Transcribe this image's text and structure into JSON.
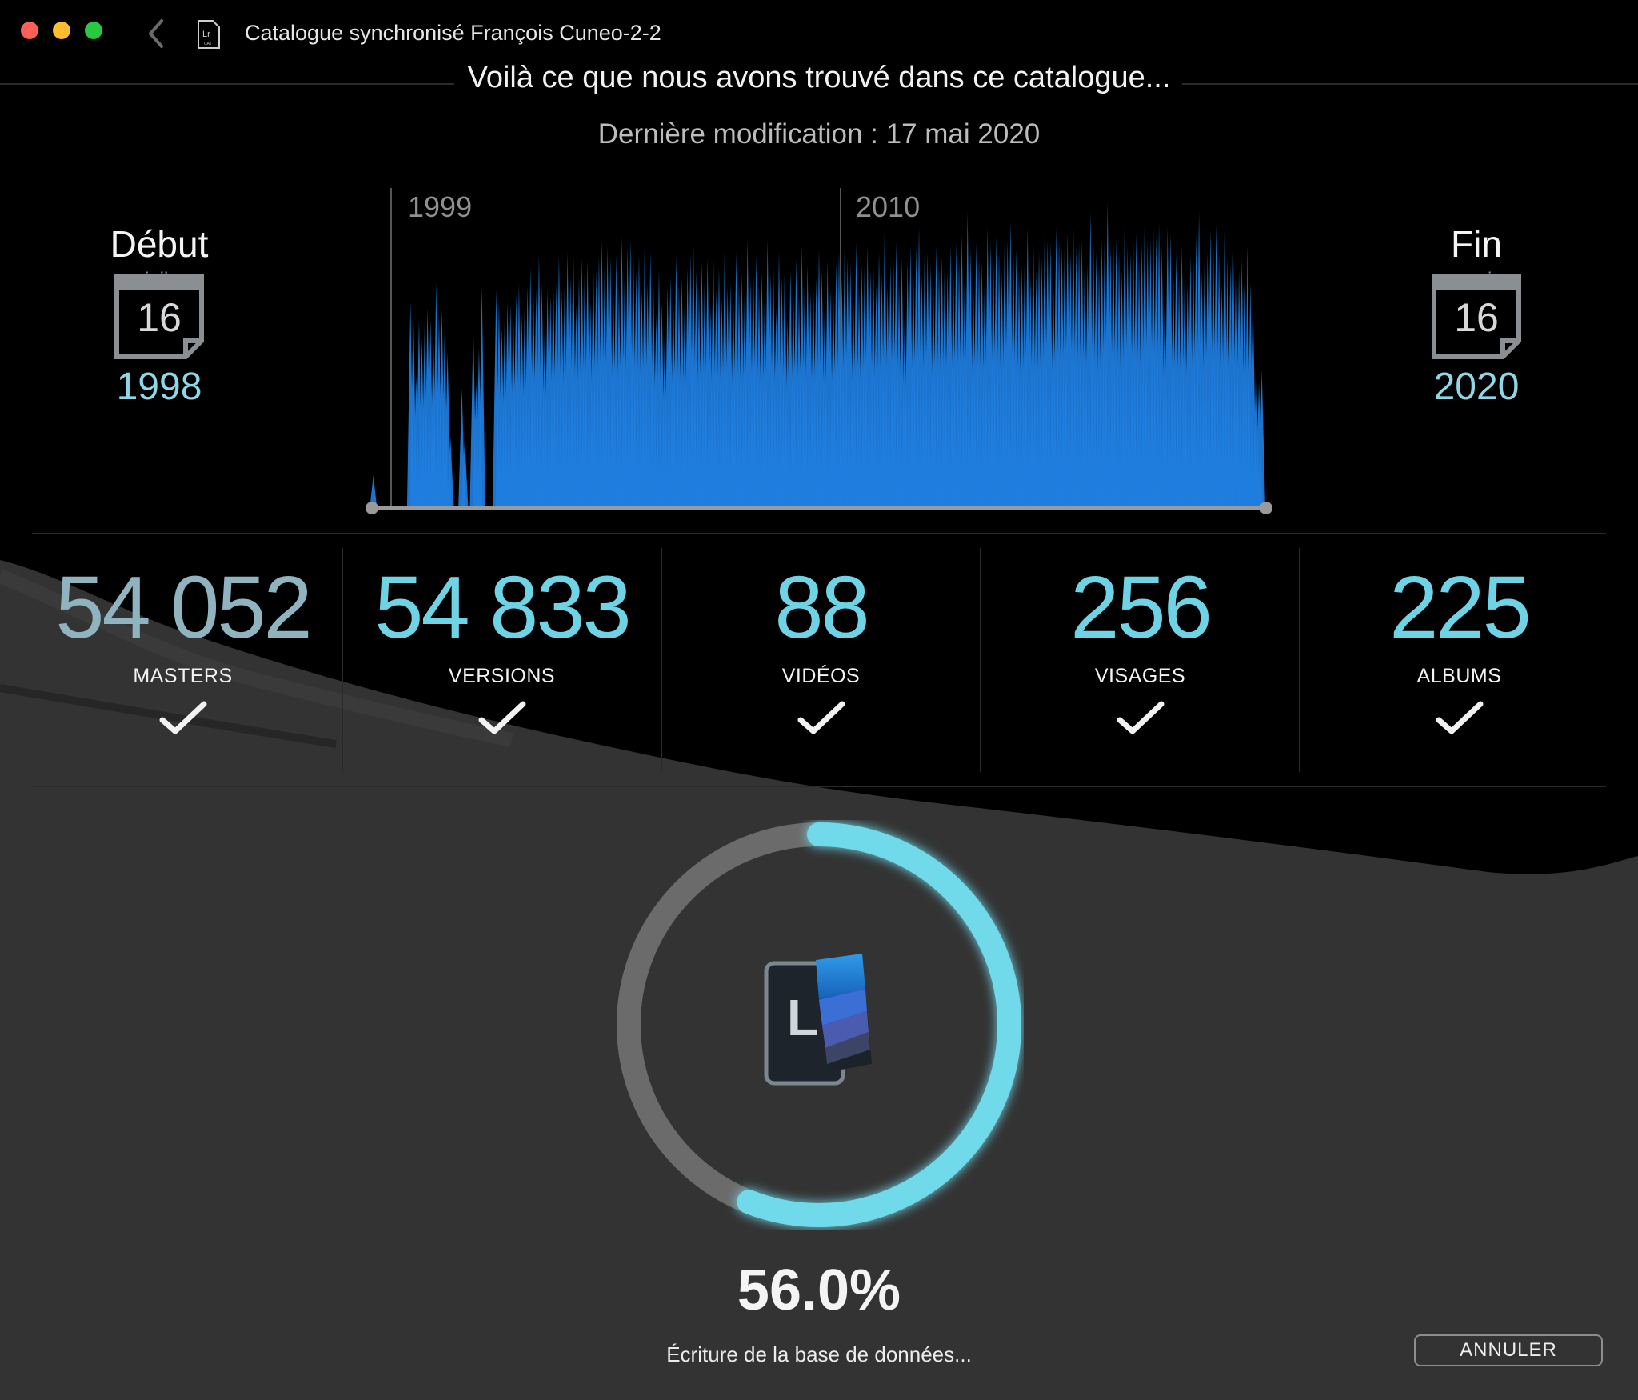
{
  "window": {
    "title": "Catalogue synchronisé François Cuneo-2-2",
    "doc_icon_label": "Lr",
    "doc_icon_sub": "CAT"
  },
  "header": {
    "headline": "Voilà ce que nous avons trouvé dans ce catalogue...",
    "last_modified": "Dernière modification : 17 mai 2020"
  },
  "start": {
    "label": "Début",
    "month": "juil.",
    "day": "16",
    "year": "1998"
  },
  "end": {
    "label": "Fin",
    "month": "mai",
    "day": "16",
    "year": "2020"
  },
  "chart_data": {
    "type": "area",
    "title": "",
    "xlabel": "",
    "ylabel": "",
    "x_markers": [
      "1999",
      "2010"
    ],
    "bar_color": "#1f7ee0",
    "values": [
      0.1,
      0,
      0,
      0,
      0,
      0,
      0,
      0,
      0,
      0,
      0,
      0,
      0,
      0.66,
      0.64,
      0.42,
      0.6,
      0.54,
      0.6,
      0.64,
      0.6,
      0.56,
      0.72,
      0.62,
      0.64,
      0.58,
      0.5,
      0.22,
      0,
      0,
      0,
      0.38,
      0.22,
      0,
      0,
      0.58,
      0.4,
      0.51,
      0.71,
      0,
      0,
      0,
      0,
      0.7,
      0.66,
      0.58,
      0.61,
      0.66,
      0.65,
      0.63,
      0.69,
      0.72,
      0.62,
      0.66,
      0.71,
      0.77,
      0.72,
      0.7,
      0.81,
      0.72,
      0.58,
      0.7,
      0.68,
      0.74,
      0.72,
      0.81,
      0.7,
      0.73,
      0.82,
      0.74,
      0.85,
      0.65,
      0.74,
      0.8,
      0.77,
      0.79,
      0.66,
      0.8,
      0.76,
      0.81,
      0.86,
      0.8,
      0.84,
      0.8,
      0.72,
      0.81,
      0.7,
      0.87,
      0.76,
      0.84,
      0.86,
      0.84,
      0.76,
      0.81,
      0.7,
      0.86,
      0.72,
      0.82,
      0.75,
      0.62,
      0.76,
      0.66,
      0.56,
      0.71,
      0.74,
      0.69,
      0.81,
      0.71,
      0.74,
      0.67,
      0.77,
      0.81,
      0.88,
      0.76,
      0.7,
      0.79,
      0.75,
      0.8,
      0.64,
      0.83,
      0.7,
      0.77,
      0.67,
      0.85,
      0.71,
      0.72,
      0.69,
      0.82,
      0.72,
      0.75,
      0.7,
      0.86,
      0.73,
      0.78,
      0.81,
      0.71,
      0.76,
      0.68,
      0.86,
      0.75,
      0.8,
      0.64,
      0.82,
      0.74,
      0.78,
      0.6,
      0.76,
      0.71,
      0.8,
      0.68,
      0.84,
      0.73,
      0.78,
      0.69,
      0.73,
      0.74,
      0.83,
      0.77,
      0.66,
      0.79,
      0.7,
      0.71,
      0.79,
      0.82,
      0.74,
      0.86,
      0.8,
      0.78,
      0.7,
      0.85,
      0.71,
      0.78,
      0.81,
      0.84,
      0.76,
      0.8,
      0.72,
      0.82,
      0.75,
      0.92,
      0.71,
      0.78,
      0.83,
      0.85,
      0.73,
      0.8,
      0.63,
      0.79,
      0.84,
      0.78,
      0.84,
      0.9,
      0.75,
      0.85,
      0.82,
      0.78,
      0.74,
      0.84,
      0.78,
      0.81,
      0.8,
      0.76,
      0.84,
      0.78,
      0.85,
      0.8,
      0.88,
      0.76,
      0.95,
      0.83,
      0.74,
      0.85,
      0.8,
      0.79,
      0.75,
      0.9,
      0.85,
      0.83,
      0.87,
      0.82,
      0.76,
      0.89,
      0.86,
      0.92,
      0.84,
      0.83,
      0.76,
      0.78,
      0.82,
      0.9,
      0.74,
      0.87,
      0.76,
      0.82,
      0.8,
      0.91,
      0.86,
      0.85,
      0.74,
      0.9,
      0.86,
      0.84,
      0.87,
      0.88,
      0.82,
      0.92,
      0.84,
      0.85,
      0.86,
      0.8,
      0.78,
      0.95,
      0.88,
      0.82,
      0.78,
      0.86,
      0.9,
      0.98,
      0.84,
      0.88,
      0.86,
      0.82,
      0.76,
      0.94,
      0.84,
      0.82,
      0.87,
      0.88,
      0.8,
      0.85,
      0.95,
      0.86,
      0.86,
      0.92,
      0.88,
      0.91,
      0.84,
      0.68,
      0.9,
      0.88,
      0.77,
      0.82,
      0.74,
      0.84,
      0.76,
      0.72,
      0.81,
      0.82,
      0.88,
      0.95,
      0.76,
      0.84,
      0.82,
      0.89,
      0.86,
      0.91,
      0.82,
      0.72,
      0.94,
      0.8,
      0.78,
      0.82,
      0.84,
      0.76,
      0.8,
      0.72,
      0.84,
      0.72,
      0.6,
      0.46,
      0.4,
      0.44,
      0
    ]
  },
  "stats": [
    {
      "value": "54 052",
      "label": "MASTERS"
    },
    {
      "value": "54 833",
      "label": "VERSIONS"
    },
    {
      "value": "88",
      "label": "VIDÉOS"
    },
    {
      "value": "256",
      "label": "VISAGES"
    },
    {
      "value": "225",
      "label": "ALBUMS"
    }
  ],
  "progress": {
    "fraction": 0.56,
    "percent_text": "56.0%",
    "status": "Écriture de la base de données...",
    "ring_color": "#6fd9ea",
    "track_color": "#6b6b6b"
  },
  "buttons": {
    "cancel_label": "ANNULER"
  },
  "colors": {
    "accent": "#6fd3e6",
    "masters_value": "#8fb4bf",
    "background": "#000000"
  }
}
